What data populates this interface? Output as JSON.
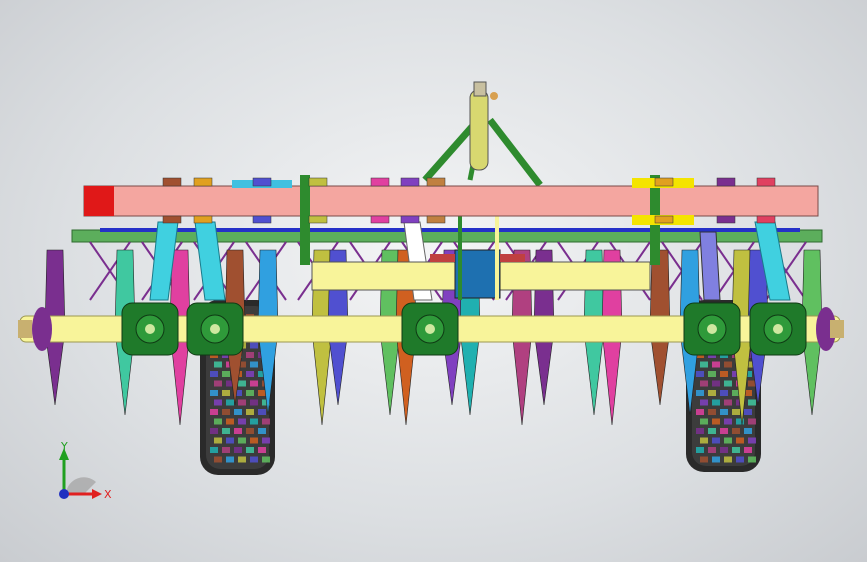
{
  "viewport": {
    "background": "#dcdfe2"
  },
  "colors": {
    "main_beam": "#f4a6a0",
    "beam_end": "#e01818",
    "frame_green": "#2e8b2e",
    "axle_yellow": "#f8f49a",
    "hitch_yellow": "#d8d870",
    "tire_dark": "#2a2a2a",
    "bearing_green": "#1f7a2a"
  },
  "triad": {
    "x_label": "X",
    "y_label": "Y",
    "x_color": "#e02020",
    "y_color": "#20a020",
    "z_color": "#2030c0"
  }
}
